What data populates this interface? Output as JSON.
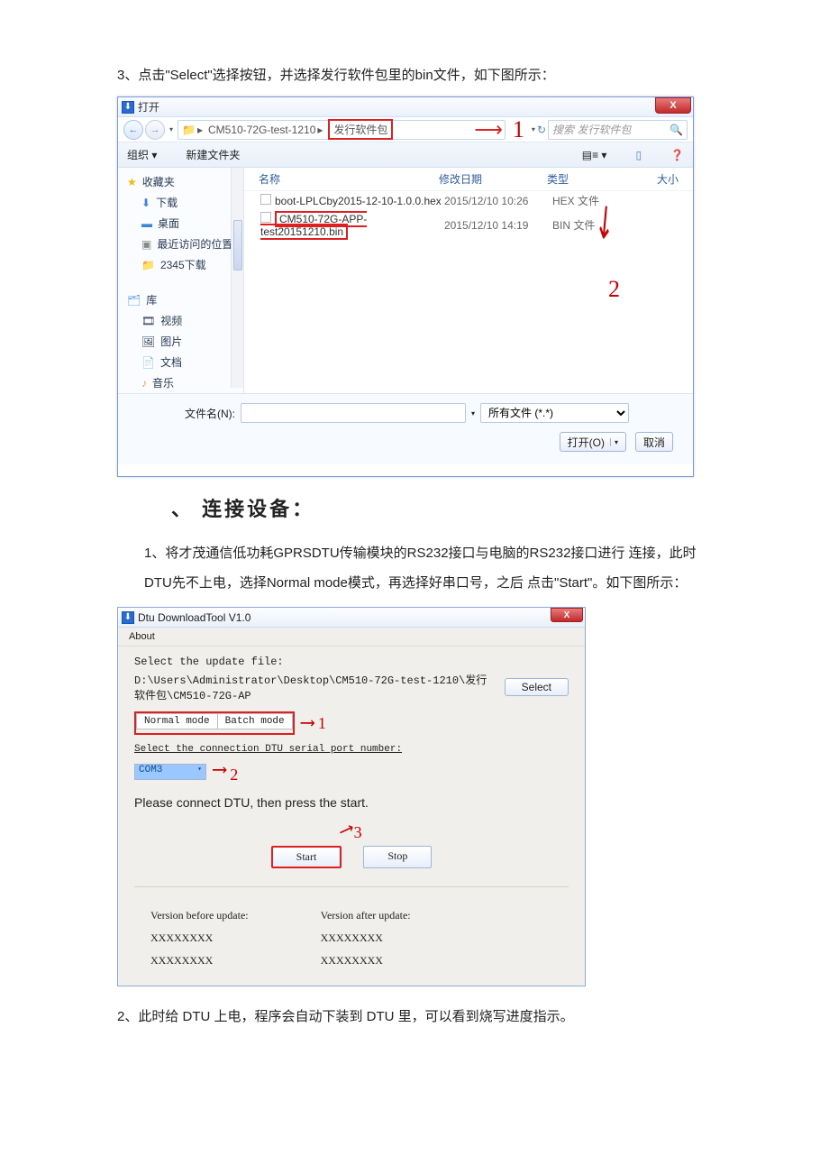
{
  "instr1": "3、点击\"Select\"选择按钮，并选择发行软件包里的bin文件，如下图所示：",
  "dialog1": {
    "title": "打开",
    "close": "X",
    "nav_back": "←",
    "nav_forward": "→",
    "path_seg1": "CM510-72G-test-1210",
    "path_seg2": "发行软件包",
    "anno1": "1",
    "anno2": "2",
    "search_placeholder": "搜索 发行软件包",
    "toolbar_org": "组织 ▾",
    "toolbar_new": "新建文件夹",
    "toolbar_view": "▤≡ ▾",
    "toolbar_help": "❓",
    "sidebar": {
      "fav": "收藏夹",
      "download": "下载",
      "desktop": "桌面",
      "recent": "最近访问的位置",
      "d2345": "2345下载",
      "lib": "库",
      "video": "视频",
      "pic": "图片",
      "doc": "文档",
      "music": "音乐"
    },
    "columns": {
      "c1": "名称",
      "c2": "修改日期",
      "c3": "类型",
      "c4": "大小"
    },
    "rows": [
      {
        "name": "boot-LPLCby2015-12-10-1.0.0.hex",
        "date": "2015/12/10 10:26",
        "type": "HEX 文件"
      },
      {
        "name": "CM510-72G-APP-test20151210.bin",
        "date": "2015/12/10 14:19",
        "type": "BIN 文件"
      }
    ],
    "fname_label": "文件名(N):",
    "filter": "所有文件 (*.*)",
    "open": "打开(O)",
    "cancel": "取消"
  },
  "heading": "、 连接设备：",
  "instr2": "1、将才茂通信低功耗GPRSDTU传输模块的RS232接口与电脑的RS232接口进行 连接，此时DTU先不上电，选择Normal mode模式，再选择好串口号，之后 点击\"Start\"。如下图所示：",
  "dialog2": {
    "title": "Dtu DownloadTool V1.0",
    "menu": "About",
    "sel_label": "Select the update file:",
    "path": "D:\\Users\\Administrator\\Desktop\\CM510-72G-test-1210\\发行软件包\\CM510-72G-AP",
    "select_btn": "Select",
    "tab1": "Normal mode",
    "tab2": "Batch mode",
    "anno1": "1",
    "conn_label": "Select the connection DTU serial port number:",
    "com": "COM3",
    "anno2": "2",
    "prompt": "Please connect DTU, then press the start.",
    "anno3": "3",
    "start": "Start",
    "stop": "Stop",
    "vbefore": "Version before update:",
    "vafter": "Version after update:",
    "x1": "XXXXXXXX",
    "x2": "XXXXXXXX",
    "x3": "XXXXXXXX",
    "x4": "XXXXXXXX"
  },
  "instr3": "2、此时给 DTU 上电，程序会自动下装到 DTU 里，可以看到烧写进度指示。"
}
